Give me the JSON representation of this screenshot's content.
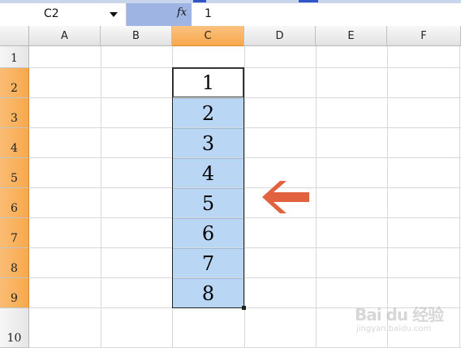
{
  "name_box": {
    "value": "C2"
  },
  "formula_bar": {
    "fx_label": "fx",
    "content": "1"
  },
  "columns": [
    "A",
    "B",
    "C",
    "D",
    "E",
    "F"
  ],
  "selected_column": "C",
  "rows": [
    "1",
    "2",
    "3",
    "4",
    "5",
    "6",
    "7",
    "8",
    "9",
    "10"
  ],
  "selected_rows": [
    "2",
    "3",
    "4",
    "5",
    "6",
    "7",
    "8",
    "9"
  ],
  "cells": {
    "C2": "1",
    "C3": "2",
    "C4": "3",
    "C5": "4",
    "C6": "5",
    "C7": "6",
    "C8": "7",
    "C9": "8"
  },
  "colors": {
    "selection_fill": "#b9d6f5",
    "header_highlight": "#f7a84c",
    "arrow": "#e0623f"
  },
  "icons": {
    "name_box_dropdown": "triangle-down-icon",
    "annotation": "arrow-left-icon"
  },
  "watermark": {
    "line1": "Bai du 经验",
    "line2": "jingyan.baidu.com"
  }
}
